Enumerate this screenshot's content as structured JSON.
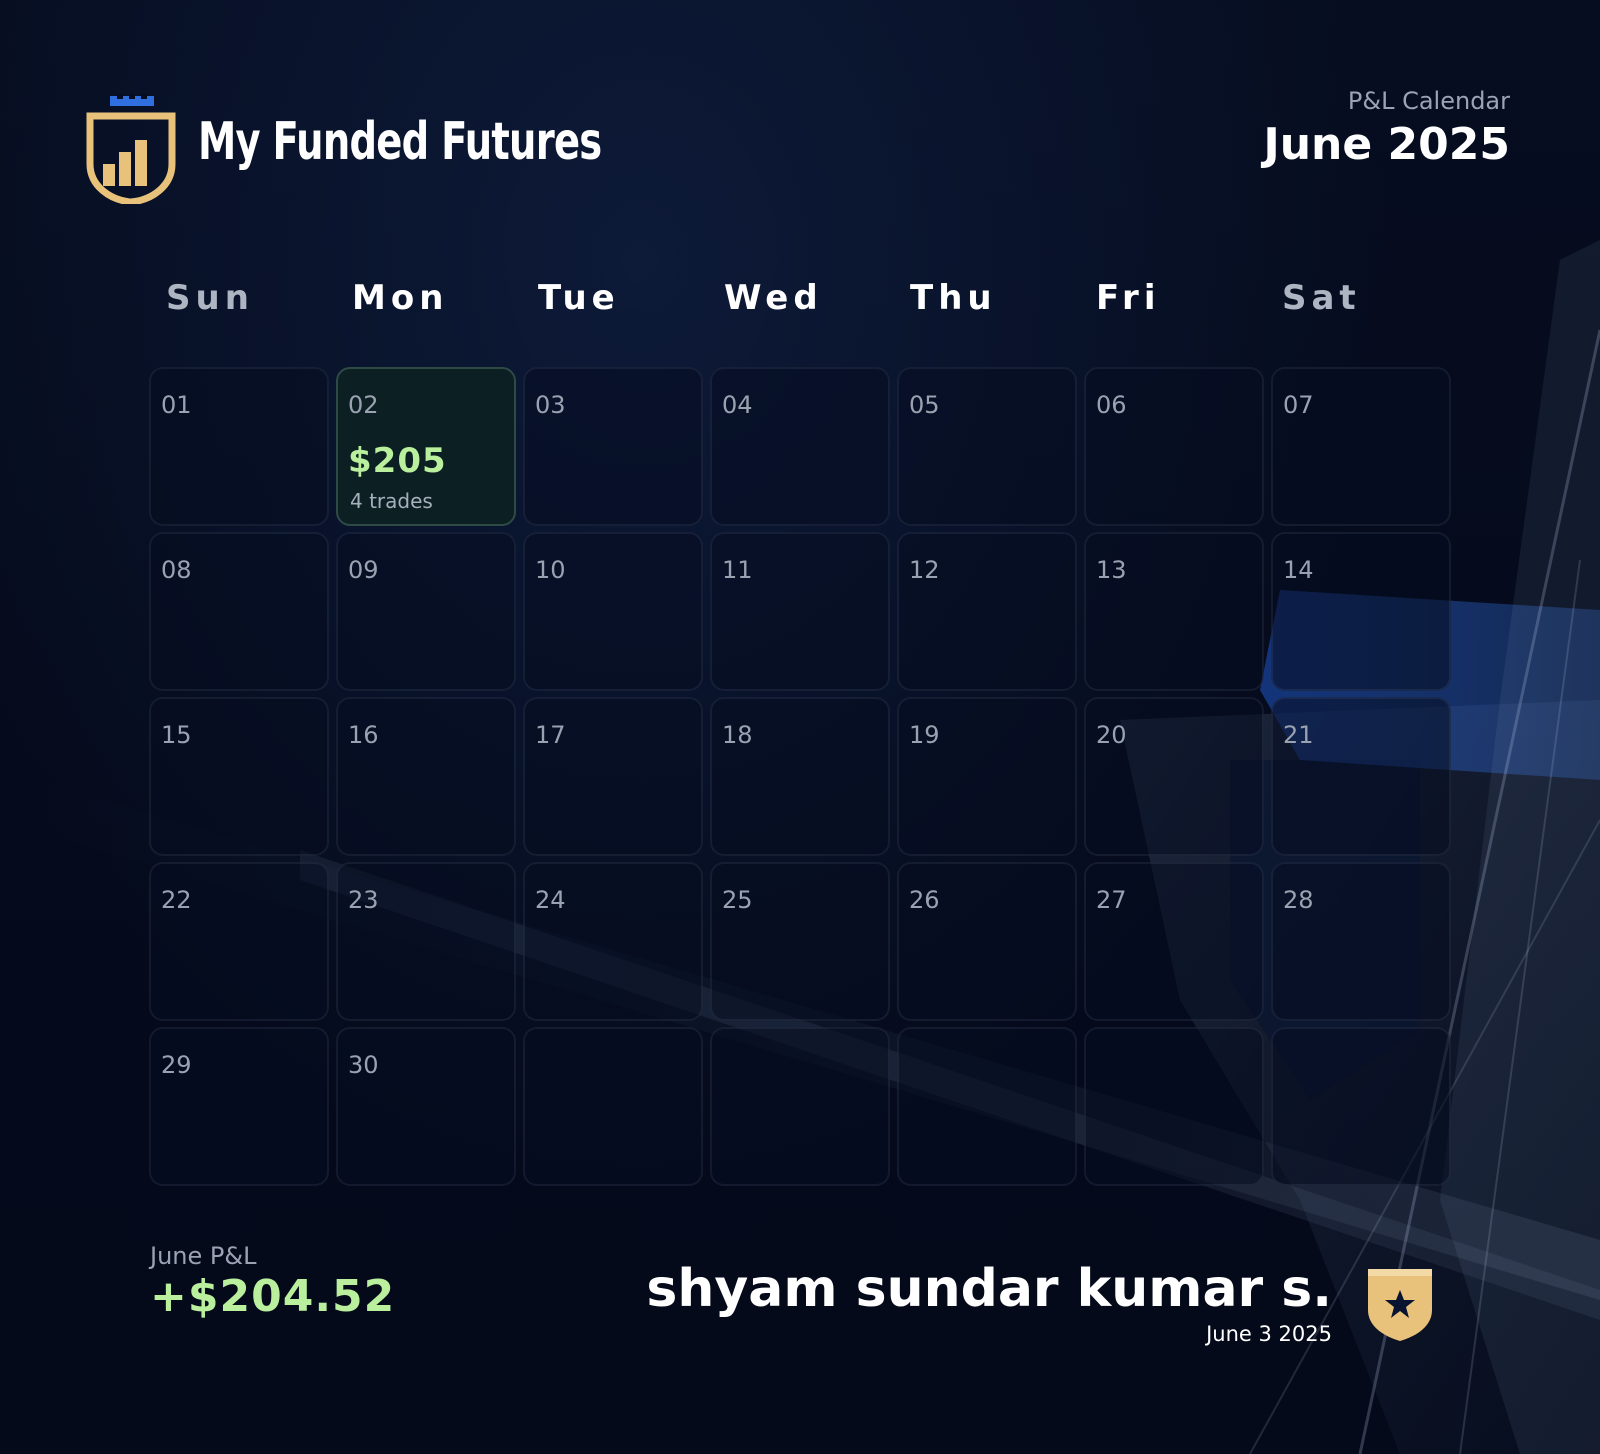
{
  "brand": {
    "name": "My Funded Futures",
    "logo_icon": "shield-bar-chart-icon",
    "logo_colors": {
      "gold": "#e8c27b",
      "blue": "#2f6fe0"
    }
  },
  "header": {
    "subtitle": "P&L Calendar",
    "title": "June 2025"
  },
  "calendar": {
    "weekdays": [
      "Sun",
      "Mon",
      "Tue",
      "Wed",
      "Thu",
      "Fri",
      "Sat"
    ],
    "days": [
      {
        "day": "01"
      },
      {
        "day": "02",
        "amount": "$205",
        "trades": "4 trades",
        "profit": true
      },
      {
        "day": "03"
      },
      {
        "day": "04"
      },
      {
        "day": "05"
      },
      {
        "day": "06"
      },
      {
        "day": "07"
      },
      {
        "day": "08"
      },
      {
        "day": "09"
      },
      {
        "day": "10"
      },
      {
        "day": "11"
      },
      {
        "day": "12"
      },
      {
        "day": "13"
      },
      {
        "day": "14"
      },
      {
        "day": "15"
      },
      {
        "day": "16"
      },
      {
        "day": "17"
      },
      {
        "day": "18"
      },
      {
        "day": "19"
      },
      {
        "day": "20"
      },
      {
        "day": "21"
      },
      {
        "day": "22"
      },
      {
        "day": "23"
      },
      {
        "day": "24"
      },
      {
        "day": "25"
      },
      {
        "day": "26"
      },
      {
        "day": "27"
      },
      {
        "day": "28"
      },
      {
        "day": "29"
      },
      {
        "day": "30"
      },
      {
        "day": ""
      },
      {
        "day": ""
      },
      {
        "day": ""
      },
      {
        "day": ""
      },
      {
        "day": ""
      }
    ],
    "profit_color": "#b9ef9d"
  },
  "footer": {
    "pl_label": "June P&L",
    "pl_value": "+$204.52",
    "user_name": "shyam sundar kumar s.",
    "date": "June 3 2025",
    "badge_icon": "star-badge-icon"
  }
}
